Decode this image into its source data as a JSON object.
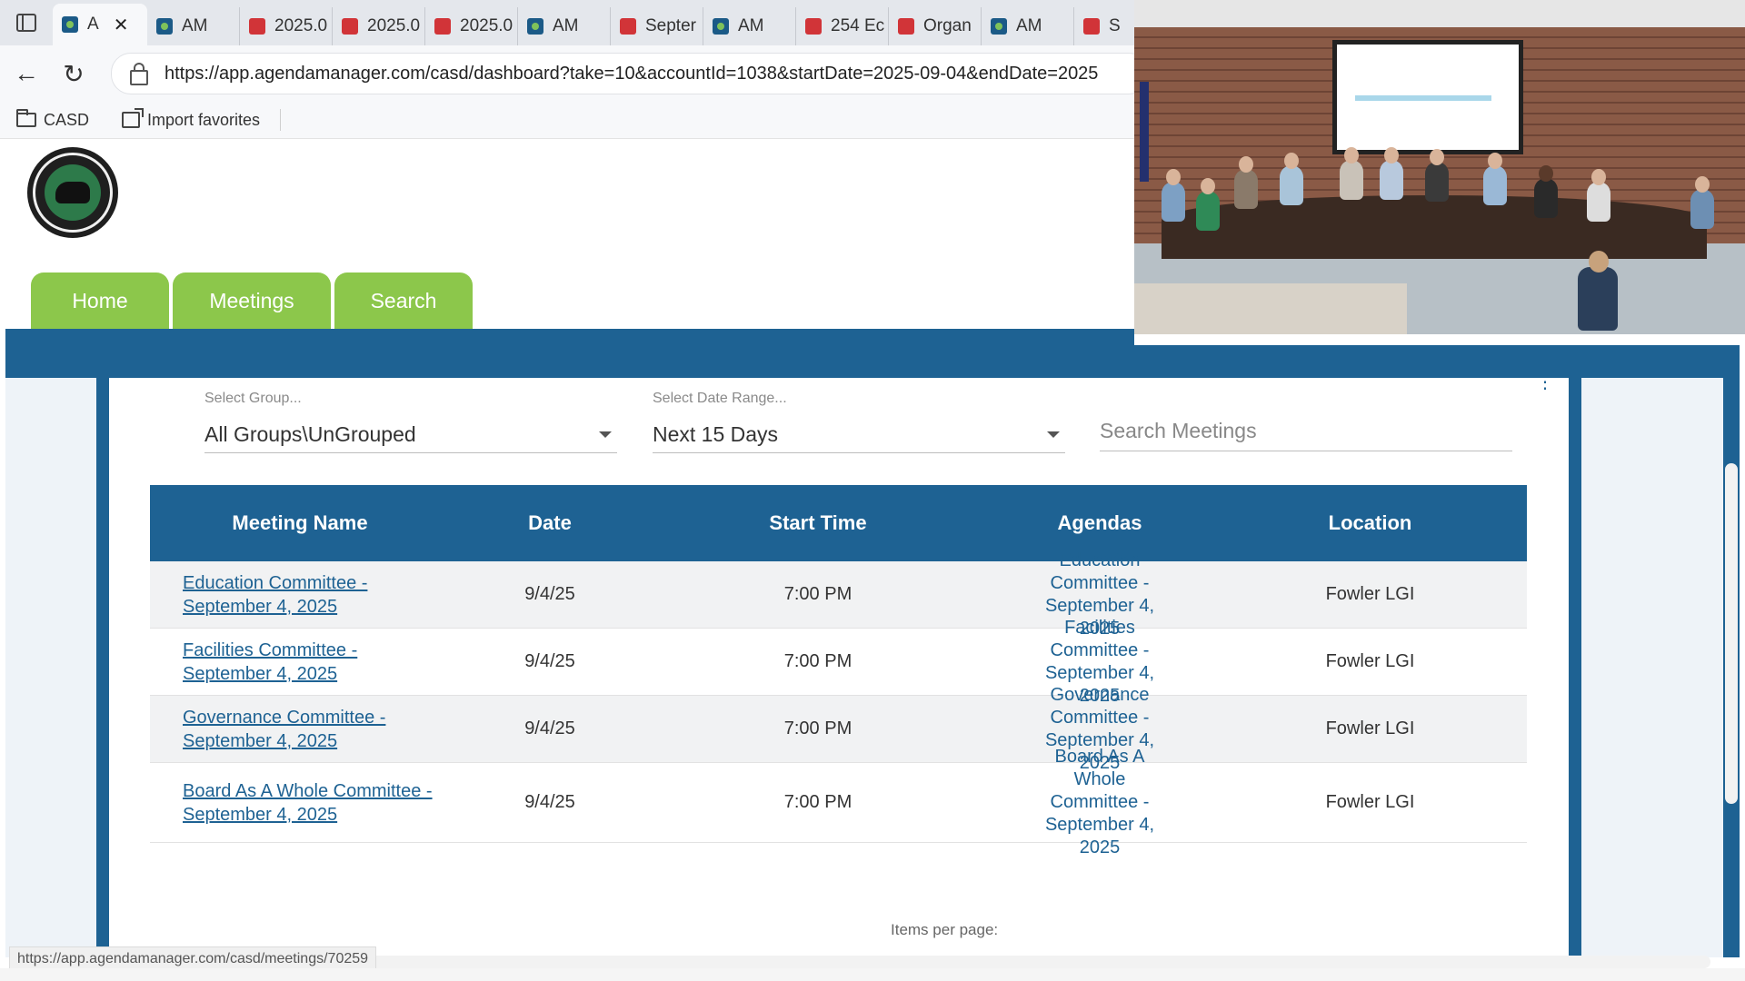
{
  "browser": {
    "tabs": [
      {
        "label": "A",
        "icon": "am",
        "active": true
      },
      {
        "label": "AM",
        "icon": "am"
      },
      {
        "label": "2025.0",
        "icon": "pdf"
      },
      {
        "label": "2025.0",
        "icon": "pdf"
      },
      {
        "label": "2025.0",
        "icon": "pdf"
      },
      {
        "label": "AM",
        "icon": "am"
      },
      {
        "label": "Septer",
        "icon": "pdf"
      },
      {
        "label": "AM",
        "icon": "am"
      },
      {
        "label": "254 Ec",
        "icon": "pdf"
      },
      {
        "label": "Organ",
        "icon": "pdf"
      },
      {
        "label": "AM",
        "icon": "am"
      },
      {
        "label": "S",
        "icon": "pdf"
      }
    ],
    "url": "https://app.agendamanager.com/casd/dashboard?take=10&accountId=1038&startDate=2025-09-04&endDate=2025",
    "favorites": [
      {
        "label": "CASD",
        "icon": "folder-icon"
      },
      {
        "label": "Import favorites",
        "icon": "import-icon"
      }
    ],
    "status_url": "https://app.agendamanager.com/casd/meetings/70259"
  },
  "nav": {
    "home": "Home",
    "meetings": "Meetings",
    "search": "Search",
    "color": "#8cc74b"
  },
  "theme": {
    "primary": "#1e6293"
  },
  "filters": {
    "group_label": "Select Group...",
    "group_value": "All Groups\\UnGrouped",
    "date_label": "Select Date Range...",
    "date_value": "Next 15 Days",
    "search_placeholder": "Search Meetings"
  },
  "table": {
    "headers": {
      "name": "Meeting Name",
      "date": "Date",
      "start": "Start Time",
      "agendas": "Agendas",
      "location": "Location"
    },
    "rows": [
      {
        "name": "Education Committee - September 4, 2025",
        "date": "9/4/25",
        "start": "7:00 PM",
        "agenda": "Education Committee - September 4, 2025",
        "location": "Fowler LGI"
      },
      {
        "name": "Facilities Committee - September 4, 2025",
        "date": "9/4/25",
        "start": "7:00 PM",
        "agenda": "Facilities Committee - September 4, 2025",
        "location": "Fowler LGI"
      },
      {
        "name": "Governance Committee - September 4, 2025",
        "date": "9/4/25",
        "start": "7:00 PM",
        "agenda": "Governance Committee - September 4, 2025",
        "location": "Fowler LGI"
      },
      {
        "name": "Board As A Whole Committee - September 4, 2025",
        "date": "9/4/25",
        "start": "7:00 PM",
        "agenda": "Board As A Whole Committee - September 4, 2025",
        "location": "Fowler LGI"
      }
    ]
  },
  "pagination": {
    "items_per_page_label": "Items per page:"
  }
}
